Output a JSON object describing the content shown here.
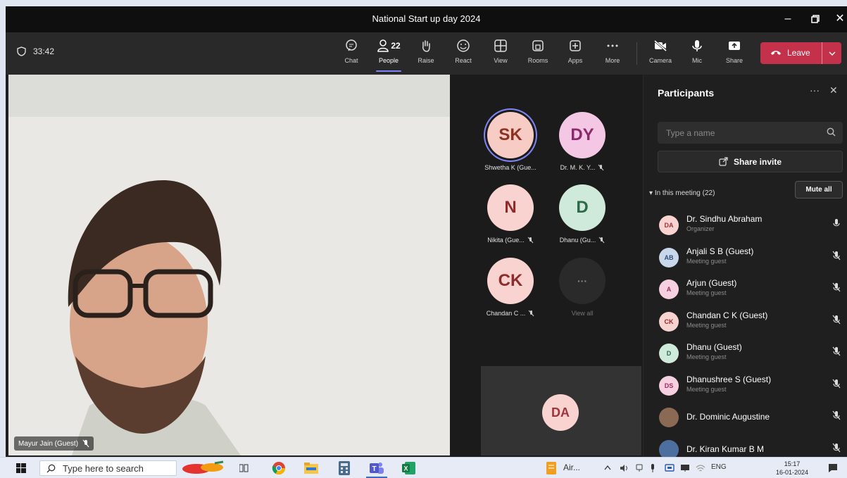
{
  "window": {
    "title": "National Start up day 2024"
  },
  "toolbar": {
    "timer": "33:42",
    "people_count": "22",
    "buttons": {
      "chat": "Chat",
      "people": "People",
      "raise": "Raise",
      "react": "React",
      "view": "View",
      "rooms": "Rooms",
      "apps": "Apps",
      "more": "More",
      "camera": "Camera",
      "mic": "Mic",
      "share": "Share"
    },
    "leave": "Leave"
  },
  "video": {
    "name": "Mayur Jain (Guest)"
  },
  "grid": {
    "tiles": [
      {
        "initials": "SK",
        "name": "Shwetha K (Gue...",
        "bg": "#f6ccc4",
        "fg": "#8c3322"
      },
      {
        "initials": "DY",
        "name": "Dr. M. K. Y...",
        "bg": "#f4c7e4",
        "fg": "#8d2a6e"
      },
      {
        "initials": "N",
        "name": "Nikita (Gue...",
        "bg": "#f9d3d0",
        "fg": "#8e2b2b"
      },
      {
        "initials": "D",
        "name": "Dhanu (Gu...",
        "bg": "#cfeadb",
        "fg": "#2b6b48"
      },
      {
        "initials": "CK",
        "name": "Chandan C ...",
        "bg": "#f9d3d0",
        "fg": "#8e2b2b"
      },
      {
        "initials": "···",
        "name": "View all",
        "bg": "#2a2a2a",
        "fg": "#8a8a8a"
      }
    ],
    "self_initials": "DA"
  },
  "panel": {
    "title": "Participants",
    "search_placeholder": "Type a name",
    "share_invite": "Share invite",
    "in_meeting": "In this meeting (22)",
    "mute_all": "Mute all",
    "participants": [
      {
        "initials": "DA",
        "name": "Dr. Sindhu Abraham",
        "role": "Organizer",
        "bg": "#f9d3d0",
        "fg": "#a0343c",
        "mic": "on"
      },
      {
        "initials": "AB",
        "name": "Anjali S B (Guest)",
        "role": "Meeting guest",
        "bg": "#c9d7ea",
        "fg": "#2f4f7a",
        "mic": "off"
      },
      {
        "initials": "A",
        "name": "Arjun (Guest)",
        "role": "Meeting guest",
        "bg": "#f6cfe1",
        "fg": "#9c2b62",
        "mic": "off"
      },
      {
        "initials": "CK",
        "name": "Chandan C K (Guest)",
        "role": "Meeting guest",
        "bg": "#f9d3d0",
        "fg": "#8e2b2b",
        "mic": "off"
      },
      {
        "initials": "D",
        "name": "Dhanu (Guest)",
        "role": "Meeting guest",
        "bg": "#cfeadb",
        "fg": "#2b6b48",
        "mic": "off"
      },
      {
        "initials": "DS",
        "name": "Dhanushree S (Guest)",
        "role": "Meeting guest",
        "bg": "#f6cfe1",
        "fg": "#9c2b62",
        "mic": "off"
      },
      {
        "initials": "",
        "name": "Dr. Dominic Augustine",
        "role": "",
        "bg": "#8b6a55",
        "fg": "#fff",
        "mic": "off"
      },
      {
        "initials": "",
        "name": "Dr. Kiran Kumar B M",
        "role": "",
        "bg": "#4d6fa0",
        "fg": "#fff",
        "mic": "off"
      }
    ]
  },
  "taskbar": {
    "search_placeholder": "Type here to search",
    "app_label": "Air...",
    "lang": "ENG",
    "time": "15:17",
    "date": "16-01-2024"
  }
}
